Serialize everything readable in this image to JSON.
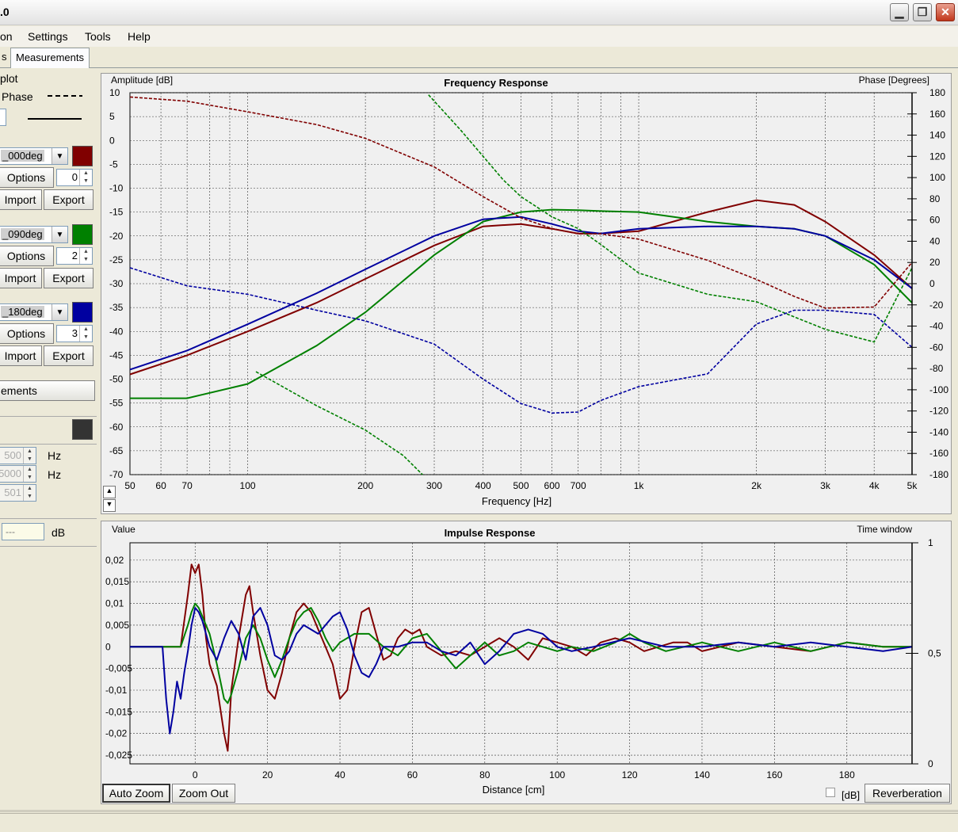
{
  "window": {
    "title": ".0"
  },
  "menu": [
    "on",
    "Settings",
    "Tools",
    "Help"
  ],
  "tabs": [
    "s",
    "Measurements"
  ],
  "left": {
    "section_label": "plot",
    "phase_label": "Phase",
    "measurements": [
      {
        "name": "_000deg",
        "color": "#800000",
        "options_label": "Options",
        "value": "0",
        "import_label": "Import",
        "export_label": "Export"
      },
      {
        "name": "_090deg",
        "color": "#008000",
        "options_label": "Options",
        "value": "2",
        "import_label": "Import",
        "export_label": "Export"
      },
      {
        "name": "_180deg",
        "color": "#0000a0",
        "options_label": "Options",
        "value": "3",
        "import_label": "Import",
        "export_label": "Export"
      }
    ],
    "ements_button": "ements",
    "dark_swatch": "#333333",
    "hz_fields": [
      {
        "value": "500",
        "unit": "Hz"
      },
      {
        "value": "5000",
        "unit": "Hz"
      },
      {
        "value": "501",
        "unit": ""
      }
    ],
    "db_field": {
      "value": "---",
      "unit": "dB"
    }
  },
  "fr": {
    "title": "Frequency Response",
    "ylabel_left": "Amplitude [dB]",
    "ylabel_right": "Phase [Degrees]",
    "xlabel": "Frequency [Hz]",
    "left_ticks": [
      "10",
      "5",
      "0",
      "-5",
      "-10",
      "-15",
      "-20",
      "-25",
      "-30",
      "-35",
      "-40",
      "-45",
      "-50",
      "-55",
      "-60",
      "-65",
      "-70"
    ],
    "right_ticks": [
      "180",
      "160",
      "140",
      "120",
      "100",
      "80",
      "60",
      "40",
      "20",
      "0",
      "-20",
      "-40",
      "-60",
      "-80",
      "-100",
      "-120",
      "-140",
      "-160",
      "-180"
    ],
    "x_ticks": [
      "50",
      "60",
      "70",
      "100",
      "200",
      "300",
      "400",
      "500",
      "600",
      "700",
      "1k",
      "2k",
      "3k",
      "4k",
      "5k"
    ],
    "scroll_up": "▲",
    "scroll_down": "▼"
  },
  "ir": {
    "title": "Impulse Response",
    "ylabel_left": "Value",
    "ylabel_right": "Time window",
    "xlabel": "Distance [cm]",
    "left_ticks": [
      "0,02",
      "0,015",
      "0,01",
      "0,005",
      "0",
      "-0,005",
      "-0,01",
      "-0,015",
      "-0,02",
      "-0,025"
    ],
    "right_ticks": [
      "1",
      "0,5",
      "0"
    ],
    "x_ticks": [
      "0",
      "20",
      "40",
      "60",
      "80",
      "100",
      "120",
      "140",
      "160",
      "180"
    ],
    "auto_zoom": "Auto Zoom",
    "zoom_out": "Zoom Out",
    "db_label": "[dB]",
    "reverb_label": "Reverberation"
  },
  "chart_data": [
    {
      "type": "line",
      "title": "Frequency Response",
      "xlabel": "Frequency [Hz]",
      "ylabel": "Amplitude [dB]",
      "y2label": "Phase [Degrees]",
      "xscale": "log",
      "xlim": [
        50,
        5000
      ],
      "ylim": [
        -70,
        10
      ],
      "y2lim": [
        -180,
        180
      ],
      "grid": true,
      "series": [
        {
          "color": "#800000",
          "axis": "amplitude",
          "style": "solid",
          "x": [
            50,
            70,
            100,
            150,
            200,
            300,
            400,
            500,
            600,
            700,
            800,
            1000,
            1500,
            2000,
            2500,
            3000,
            4000,
            5000
          ],
          "y": [
            -49,
            -45,
            -40,
            -34,
            -29,
            -22,
            -18,
            -17.5,
            -18.5,
            -19.5,
            -19.5,
            -19,
            -15,
            -12.5,
            -13.5,
            -17,
            -24,
            -31
          ]
        },
        {
          "color": "#008000",
          "axis": "amplitude",
          "style": "solid",
          "x": [
            50,
            70,
            100,
            150,
            200,
            300,
            400,
            500,
            600,
            700,
            800,
            1000,
            1500,
            2000,
            2500,
            3000,
            4000,
            5000
          ],
          "y": [
            -54,
            -54,
            -51,
            -43,
            -36,
            -24,
            -17,
            -15,
            -14.5,
            -14.6,
            -14.8,
            -15,
            -17,
            -18,
            -18.5,
            -20,
            -26,
            -34
          ]
        },
        {
          "color": "#0000a0",
          "axis": "amplitude",
          "style": "solid",
          "x": [
            50,
            70,
            100,
            150,
            200,
            300,
            400,
            500,
            600,
            700,
            800,
            1000,
            1500,
            2000,
            2500,
            3000,
            4000,
            5000
          ],
          "y": [
            -48,
            -44,
            -38.5,
            -32,
            -27,
            -20,
            -16.5,
            -16,
            -17.5,
            -19,
            -19.5,
            -18.5,
            -18,
            -18,
            -18.5,
            -20,
            -25,
            -31
          ]
        },
        {
          "color": "#800000",
          "axis": "phase",
          "style": "dashed",
          "x": [
            50,
            70,
            100,
            150,
            200,
            300,
            400,
            500,
            600,
            700,
            800,
            1000,
            1500,
            2000,
            2500,
            3000,
            4000,
            5000
          ],
          "y": [
            176,
            172,
            162,
            150,
            137,
            110,
            82,
            62,
            52,
            47,
            47,
            42,
            22,
            4,
            -12,
            -23,
            -22,
            20
          ]
        },
        {
          "color": "#008000",
          "axis": "phase",
          "style": "dashed",
          "x": [
            290,
            350,
            400,
            450,
            500,
            600,
            700,
            800,
            1000,
            1500,
            2000,
            3000,
            4000,
            5000
          ],
          "y": [
            178,
            145,
            120,
            98,
            82,
            63,
            52,
            37,
            10,
            -10,
            -17,
            -43,
            -55,
            15
          ]
        },
        {
          "color": "#008000",
          "axis": "phase",
          "style": "dashed",
          "x": [
            105,
            150,
            200,
            250,
            280
          ],
          "y": [
            -83,
            -115,
            -138,
            -162,
            -180
          ]
        },
        {
          "color": "#0000a0",
          "axis": "phase",
          "style": "dashed",
          "x": [
            50,
            70,
            100,
            150,
            200,
            300,
            400,
            500,
            600,
            700,
            800,
            1000,
            1500,
            2000,
            2500,
            3000,
            4000,
            5000
          ],
          "y": [
            15,
            -2,
            -10,
            -25,
            -35,
            -57,
            -90,
            -113,
            -122,
            -121,
            -110,
            -97,
            -85,
            -38,
            -25,
            -25,
            -29,
            -60
          ]
        }
      ]
    },
    {
      "type": "line",
      "title": "Impulse Response",
      "xlabel": "Distance [cm]",
      "ylabel": "Value",
      "y2label": "Time window",
      "xlim": [
        -18,
        198
      ],
      "ylim": [
        -0.027,
        0.024
      ],
      "y2lim": [
        0,
        1
      ],
      "grid": true,
      "series": [
        {
          "color": "#800000",
          "x": [
            -18,
            -4,
            -2,
            -1,
            0,
            1,
            2,
            3,
            4,
            6,
            8,
            9,
            10,
            12,
            14,
            15,
            16,
            18,
            20,
            22,
            24,
            26,
            28,
            30,
            32,
            34,
            36,
            38,
            40,
            42,
            44,
            46,
            48,
            50,
            52,
            54,
            56,
            58,
            60,
            62,
            64,
            68,
            72,
            76,
            80,
            84,
            88,
            92,
            96,
            100,
            104,
            108,
            112,
            116,
            120,
            124,
            128,
            132,
            136,
            140,
            150,
            160,
            170,
            180,
            190,
            198
          ],
          "y": [
            0,
            0,
            0.012,
            0.019,
            0.017,
            0.019,
            0.012,
            0.002,
            -0.004,
            -0.009,
            -0.02,
            -0.024,
            -0.01,
            0.002,
            0.012,
            0.014,
            0.008,
            -0.002,
            -0.01,
            -0.012,
            -0.006,
            0.002,
            0.008,
            0.01,
            0.008,
            0.004,
            0,
            -0.004,
            -0.012,
            -0.01,
            0,
            0.008,
            0.009,
            0.003,
            -0.003,
            -0.002,
            0.002,
            0.004,
            0.003,
            0.004,
            0,
            -0.002,
            -0.001,
            -0.002,
            0,
            0.002,
            0,
            -0.003,
            0.002,
            0.001,
            0,
            -0.002,
            0.001,
            0.002,
            0.001,
            -0.001,
            0,
            0.001,
            0.001,
            -0.001,
            0.001,
            0,
            -0.001,
            0.001,
            0,
            0
          ]
        },
        {
          "color": "#008000",
          "x": [
            -18,
            -4,
            -2,
            -1,
            0,
            1,
            2,
            4,
            6,
            8,
            9,
            10,
            12,
            14,
            16,
            18,
            20,
            22,
            24,
            26,
            28,
            30,
            32,
            34,
            36,
            38,
            40,
            44,
            48,
            52,
            56,
            60,
            64,
            68,
            72,
            76,
            80,
            84,
            88,
            92,
            96,
            100,
            104,
            110,
            116,
            120,
            124,
            130,
            140,
            150,
            160,
            170,
            180,
            190,
            198
          ],
          "y": [
            0,
            0,
            0.005,
            0.008,
            0.01,
            0.009,
            0.007,
            0.003,
            -0.004,
            -0.012,
            -0.013,
            -0.011,
            -0.005,
            0.002,
            0.005,
            0.002,
            -0.003,
            -0.007,
            -0.003,
            0.002,
            0.006,
            0.008,
            0.009,
            0.006,
            0.002,
            -0.001,
            0.001,
            0.003,
            0.003,
            0,
            -0.002,
            0.002,
            0.003,
            -0.001,
            -0.005,
            -0.002,
            0.001,
            -0.002,
            -0.001,
            0.001,
            0,
            -0.001,
            0,
            -0.001,
            0.001,
            0.003,
            0.001,
            -0.001,
            0.001,
            -0.001,
            0.001,
            -0.001,
            0.001,
            0,
            0
          ]
        },
        {
          "color": "#0000a0",
          "x": [
            -18,
            -9,
            -8,
            -7,
            -6,
            -5,
            -4,
            -3,
            -2,
            -1,
            0,
            1,
            2,
            4,
            6,
            8,
            10,
            12,
            14,
            16,
            18,
            20,
            22,
            24,
            26,
            28,
            30,
            34,
            38,
            40,
            42,
            44,
            46,
            48,
            50,
            52,
            56,
            60,
            64,
            68,
            72,
            76,
            80,
            84,
            88,
            92,
            96,
            100,
            104,
            110,
            120,
            130,
            140,
            150,
            160,
            170,
            180,
            190,
            198
          ],
          "y": [
            0,
            0,
            -0.012,
            -0.02,
            -0.015,
            -0.008,
            -0.012,
            -0.006,
            -0.001,
            0.005,
            0.009,
            0.008,
            0.006,
            0,
            -0.003,
            0.002,
            0.006,
            0.003,
            -0.003,
            0.007,
            0.009,
            0.005,
            -0.002,
            -0.003,
            -0.001,
            0.003,
            0.005,
            0.003,
            0.007,
            0.008,
            0.004,
            -0.002,
            -0.006,
            -0.007,
            -0.004,
            0,
            0,
            0.001,
            0.001,
            -0.001,
            -0.002,
            0.001,
            -0.004,
            -0.001,
            0.003,
            0.004,
            0.003,
            0,
            -0.001,
            0,
            0.002,
            0,
            0,
            0.001,
            0,
            0.001,
            0,
            -0.001,
            0
          ]
        }
      ]
    }
  ]
}
